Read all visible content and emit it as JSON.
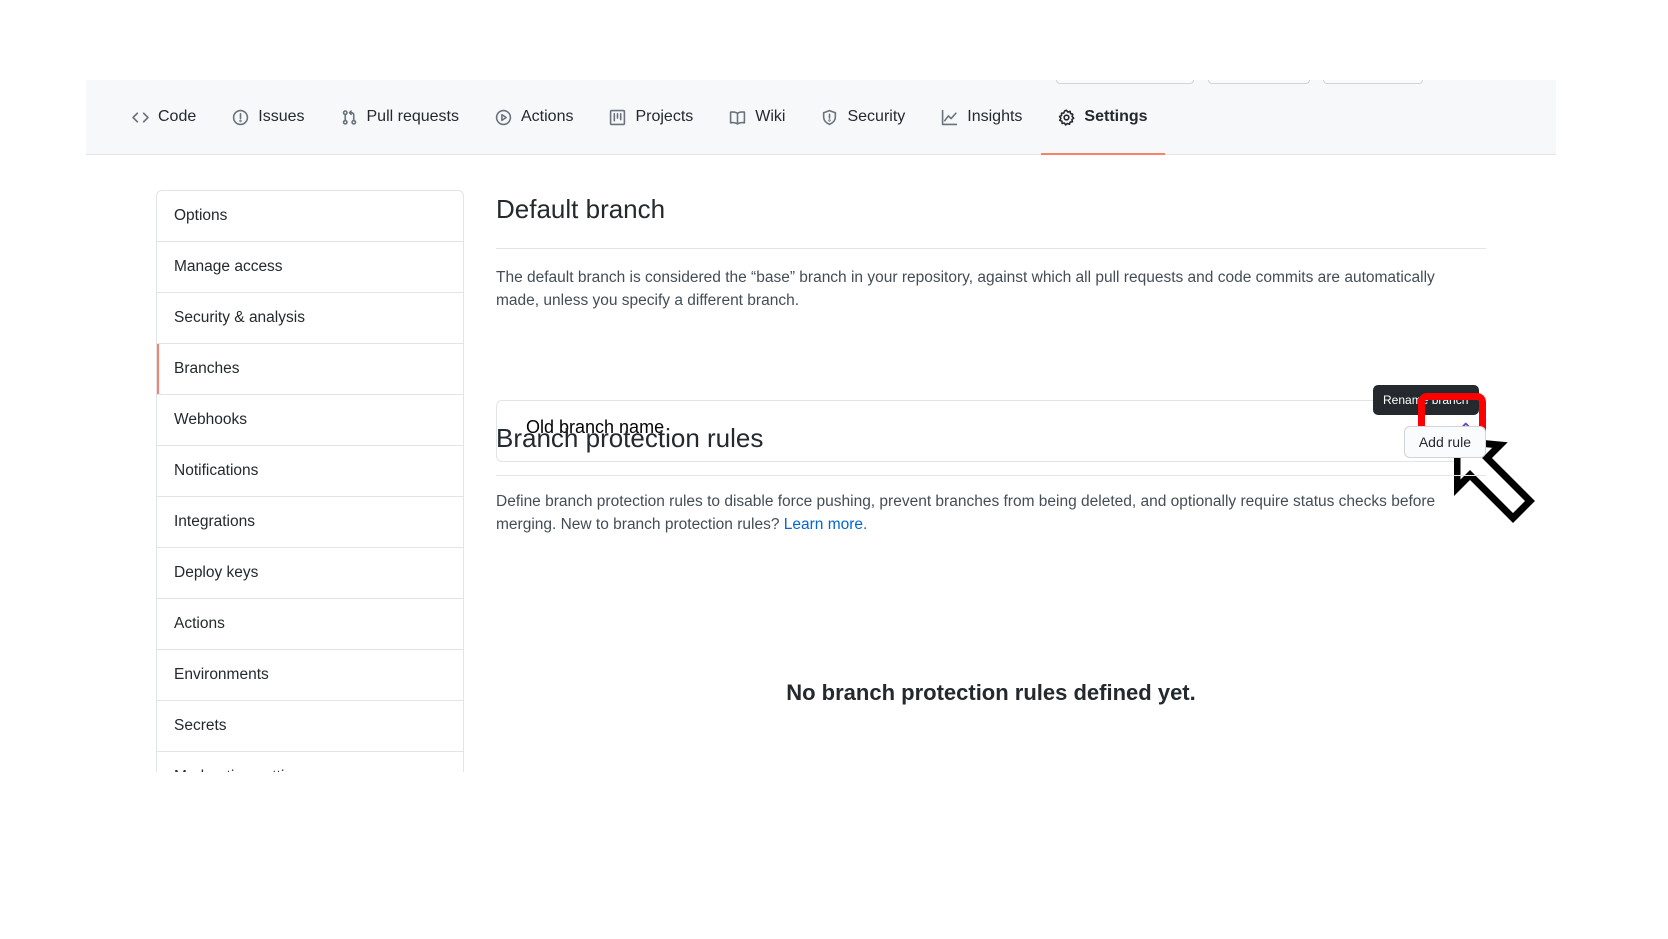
{
  "repo_nav": {
    "tabs": [
      {
        "label": "Code",
        "icon": "code-icon"
      },
      {
        "label": "Issues",
        "icon": "issue-icon"
      },
      {
        "label": "Pull requests",
        "icon": "pull-request-icon"
      },
      {
        "label": "Actions",
        "icon": "play-icon"
      },
      {
        "label": "Projects",
        "icon": "project-icon"
      },
      {
        "label": "Wiki",
        "icon": "book-icon"
      },
      {
        "label": "Security",
        "icon": "shield-icon"
      },
      {
        "label": "Insights",
        "icon": "graph-icon"
      },
      {
        "label": "Settings",
        "icon": "gear-icon",
        "selected": true
      }
    ],
    "selected_underline_color": "#f9826c"
  },
  "sidebar": {
    "items": [
      {
        "label": "Options"
      },
      {
        "label": "Manage access"
      },
      {
        "label": "Security & analysis"
      },
      {
        "label": "Branches",
        "selected": true
      },
      {
        "label": "Webhooks"
      },
      {
        "label": "Notifications"
      },
      {
        "label": "Integrations"
      },
      {
        "label": "Deploy keys"
      },
      {
        "label": "Actions"
      },
      {
        "label": "Environments"
      },
      {
        "label": "Secrets"
      },
      {
        "label": "Moderation settings"
      }
    ]
  },
  "default_branch": {
    "title": "Default branch",
    "description": "The default branch is considered the “base” branch in your repository, against which all pull requests and code commits are automatically made, unless you specify a different branch.",
    "branch_name": "Old branch name",
    "tooltip": "Rename branch",
    "edit_icon": "pencil-icon",
    "annotation_color": "#ff0000"
  },
  "protection_rules": {
    "title": "Branch protection rules",
    "add_button": "Add rule",
    "description": "Define branch protection rules to disable force pushing, prevent branches from being deleted, and optionally require status checks before merging. New to branch protection rules?",
    "learn_more": "Learn more.",
    "empty_message": "No branch protection rules defined yet."
  }
}
